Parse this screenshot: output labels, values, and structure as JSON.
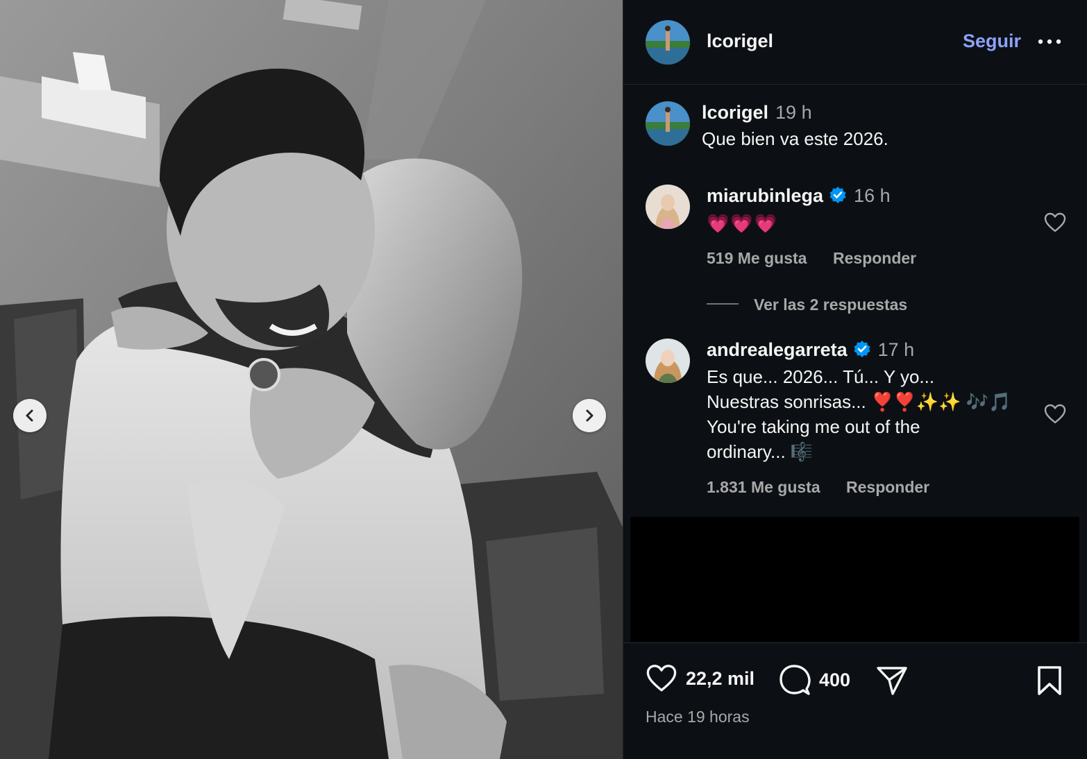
{
  "header": {
    "username": "lcorigel",
    "follow_label": "Seguir",
    "more_icon": "more-horizontal-icon"
  },
  "caption": {
    "username": "lcorigel",
    "time": "19 h",
    "text": "Que bien va este 2026."
  },
  "comments": [
    {
      "username": "miarubinlega",
      "verified": true,
      "time": "16 h",
      "text": "💗💗💗",
      "likes": "519 Me gusta",
      "reply_label": "Responder"
    },
    {
      "username": "andrealegarreta",
      "verified": true,
      "time": "17 h",
      "text_lines": [
        "Es que... 2026... Tú... Y yo...",
        "Nuestras sonrisas... ❣️❣️✨✨ 🎶🎵",
        "You're taking me out of the",
        "ordinary... 🎼"
      ],
      "likes": "1.831 Me gusta",
      "reply_label": "Responder"
    }
  ],
  "view_replies_label": "Ver las 2 respuestas",
  "actions": {
    "like_count": "22,2 mil",
    "comment_count": "400",
    "timestamp": "Hace 19 horas"
  },
  "colors": {
    "background": "#0c1014",
    "follow": "#8da2fb",
    "verified": "#0095f6",
    "secondary_text": "#a8a8a8"
  }
}
